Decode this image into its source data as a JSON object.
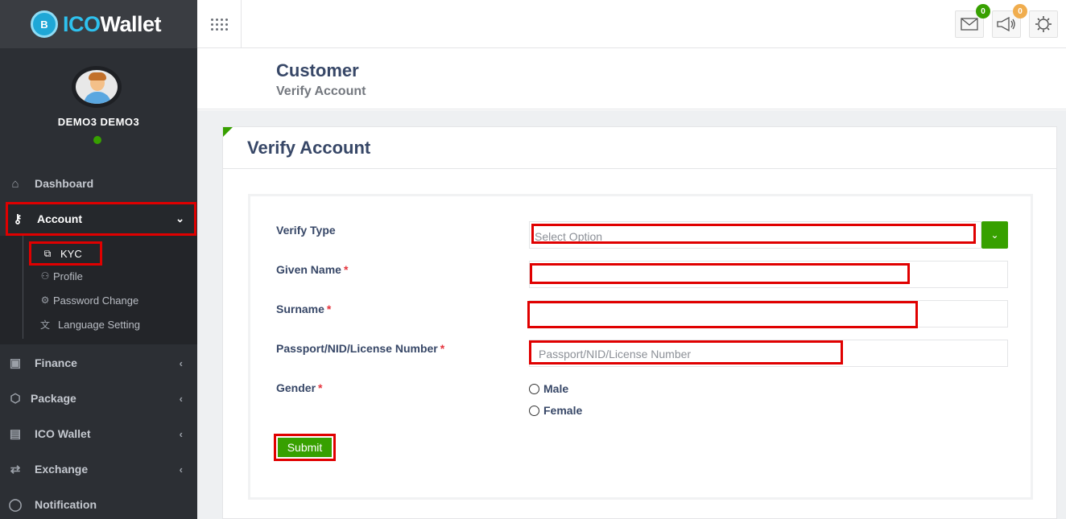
{
  "logo": {
    "prefix": "ICO",
    "suffix": "Wallet",
    "badge": "B"
  },
  "user": {
    "name": "DEMO3 DEMO3",
    "status_color": "#37a000"
  },
  "sidebar": {
    "items": [
      {
        "label": "Dashboard",
        "icon": "home-icon"
      },
      {
        "label": "Account",
        "icon": "key-icon",
        "chevron": "⌄"
      },
      {
        "label": "Finance",
        "icon": "money-icon",
        "chevron": "‹"
      },
      {
        "label": "Package",
        "icon": "box-icon",
        "chevron": "‹"
      },
      {
        "label": "ICO Wallet",
        "icon": "id-card-icon",
        "chevron": "‹"
      },
      {
        "label": "Exchange",
        "icon": "exchange-icon",
        "chevron": "‹"
      },
      {
        "label": "Notification",
        "icon": "chat-icon"
      }
    ],
    "submenu": [
      {
        "label": "KYC",
        "icon": "external-link-icon"
      },
      {
        "label": "Profile",
        "icon": "users-icon"
      },
      {
        "label": "Password Change",
        "icon": "gear-icon"
      },
      {
        "label": "Language Setting",
        "icon": "language-icon"
      }
    ]
  },
  "topbar": {
    "mail_badge": "0",
    "announce_badge": "0",
    "colors": {
      "mail_badge": "#37a000",
      "announce_badge": "#f0ad4e"
    }
  },
  "page_header": {
    "title": "Customer",
    "subtitle": "Verify Account"
  },
  "panel": {
    "title": "Verify Account"
  },
  "form": {
    "verify_type": {
      "label": "Verify Type",
      "placeholder": "Select Option"
    },
    "given_name": {
      "label": "Given Name",
      "required": "*",
      "value": ""
    },
    "surname": {
      "label": "Surname",
      "required": "*",
      "value": ""
    },
    "passport": {
      "label": "Passport/NID/License Number",
      "required": "*",
      "placeholder": "Passport/NID/License Number"
    },
    "gender": {
      "label": "Gender",
      "required": "*",
      "options": [
        "Male",
        "Female"
      ]
    },
    "submit_label": "Submit"
  },
  "colors": {
    "accent": "#37a000",
    "highlight": "#e00000",
    "sidebar_bg": "#2c2f34"
  }
}
